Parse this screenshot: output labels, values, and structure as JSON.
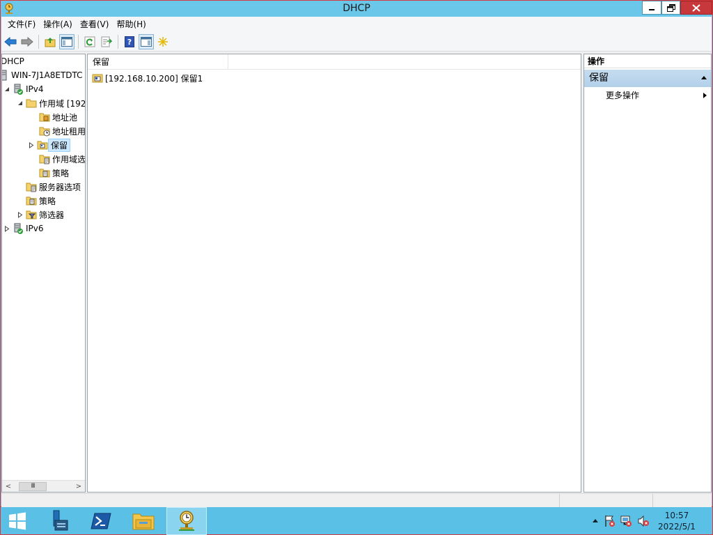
{
  "window": {
    "title": "DHCP"
  },
  "menu": [
    "文件(F)",
    "操作(A)",
    "查看(V)",
    "帮助(H)"
  ],
  "toolbar": {
    "buttons": [
      "back-icon",
      "forward-icon",
      "up-folder-icon",
      "show-hide-console-tree-icon",
      "refresh-icon",
      "export-list-icon",
      "help-icon",
      "show-hide-action-pane-icon",
      "new-icon"
    ]
  },
  "tree": {
    "root": "DHCP",
    "server": "WIN-7J1A8ETDTC",
    "ipv4": "IPv4",
    "scope": "作用域 [192",
    "address_pool": "地址池",
    "address_leases": "地址租用",
    "reservations": "保留",
    "scope_options": "作用域选",
    "scope_policies": "策略",
    "server_options": "服务器选项",
    "policies": "策略",
    "filters": "筛选器",
    "ipv6": "IPv6"
  },
  "list": {
    "column": "保留",
    "items": [
      "[192.168.10.200] 保留1"
    ]
  },
  "actions": {
    "header": "操作",
    "section": "保留",
    "more": "更多操作"
  },
  "taskbar": {
    "time": "10:57",
    "date": "2022/5/1"
  },
  "colors": {
    "titlebar": "#6ac7ea",
    "taskbar": "#5bc0e6",
    "selection": "#cce8ff",
    "action_section": "#b3d0ea"
  }
}
